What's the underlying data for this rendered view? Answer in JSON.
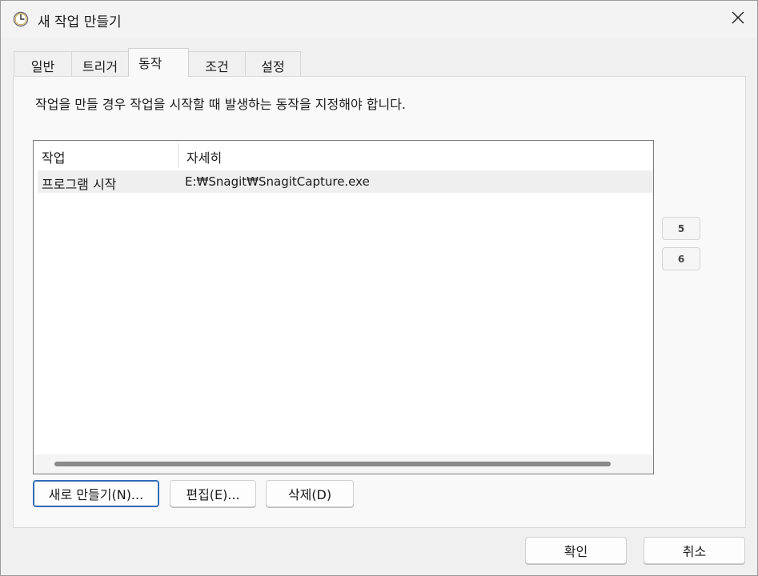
{
  "window": {
    "title": "새 작업 만들기",
    "icon": "clock-icon"
  },
  "tabs": [
    {
      "label": "일반",
      "active": false
    },
    {
      "label": "트리거",
      "active": false
    },
    {
      "label": "동작",
      "active": true
    },
    {
      "label": "조건",
      "active": false
    },
    {
      "label": "설정",
      "active": false
    }
  ],
  "panel": {
    "description": "작업을 만들 경우 작업을 시작할 때 발생하는 동작을 지정해야 합니다."
  },
  "actions_list": {
    "columns": [
      "작업",
      "자세히"
    ],
    "rows": [
      {
        "action": "프로그램 시작",
        "details": "E:₩Snagit₩SnagitCapture.exe"
      }
    ]
  },
  "side_buttons": {
    "up_label": "5",
    "down_label": "6"
  },
  "action_buttons": {
    "new_label": "새로 만들기(N)...",
    "edit_label": "편집(E)...",
    "delete_label": "삭제(D)"
  },
  "dialog_buttons": {
    "ok_label": "확인",
    "cancel_label": "취소"
  },
  "colors": {
    "accent": "#2f6bb7",
    "selected_row": "#efefef"
  }
}
